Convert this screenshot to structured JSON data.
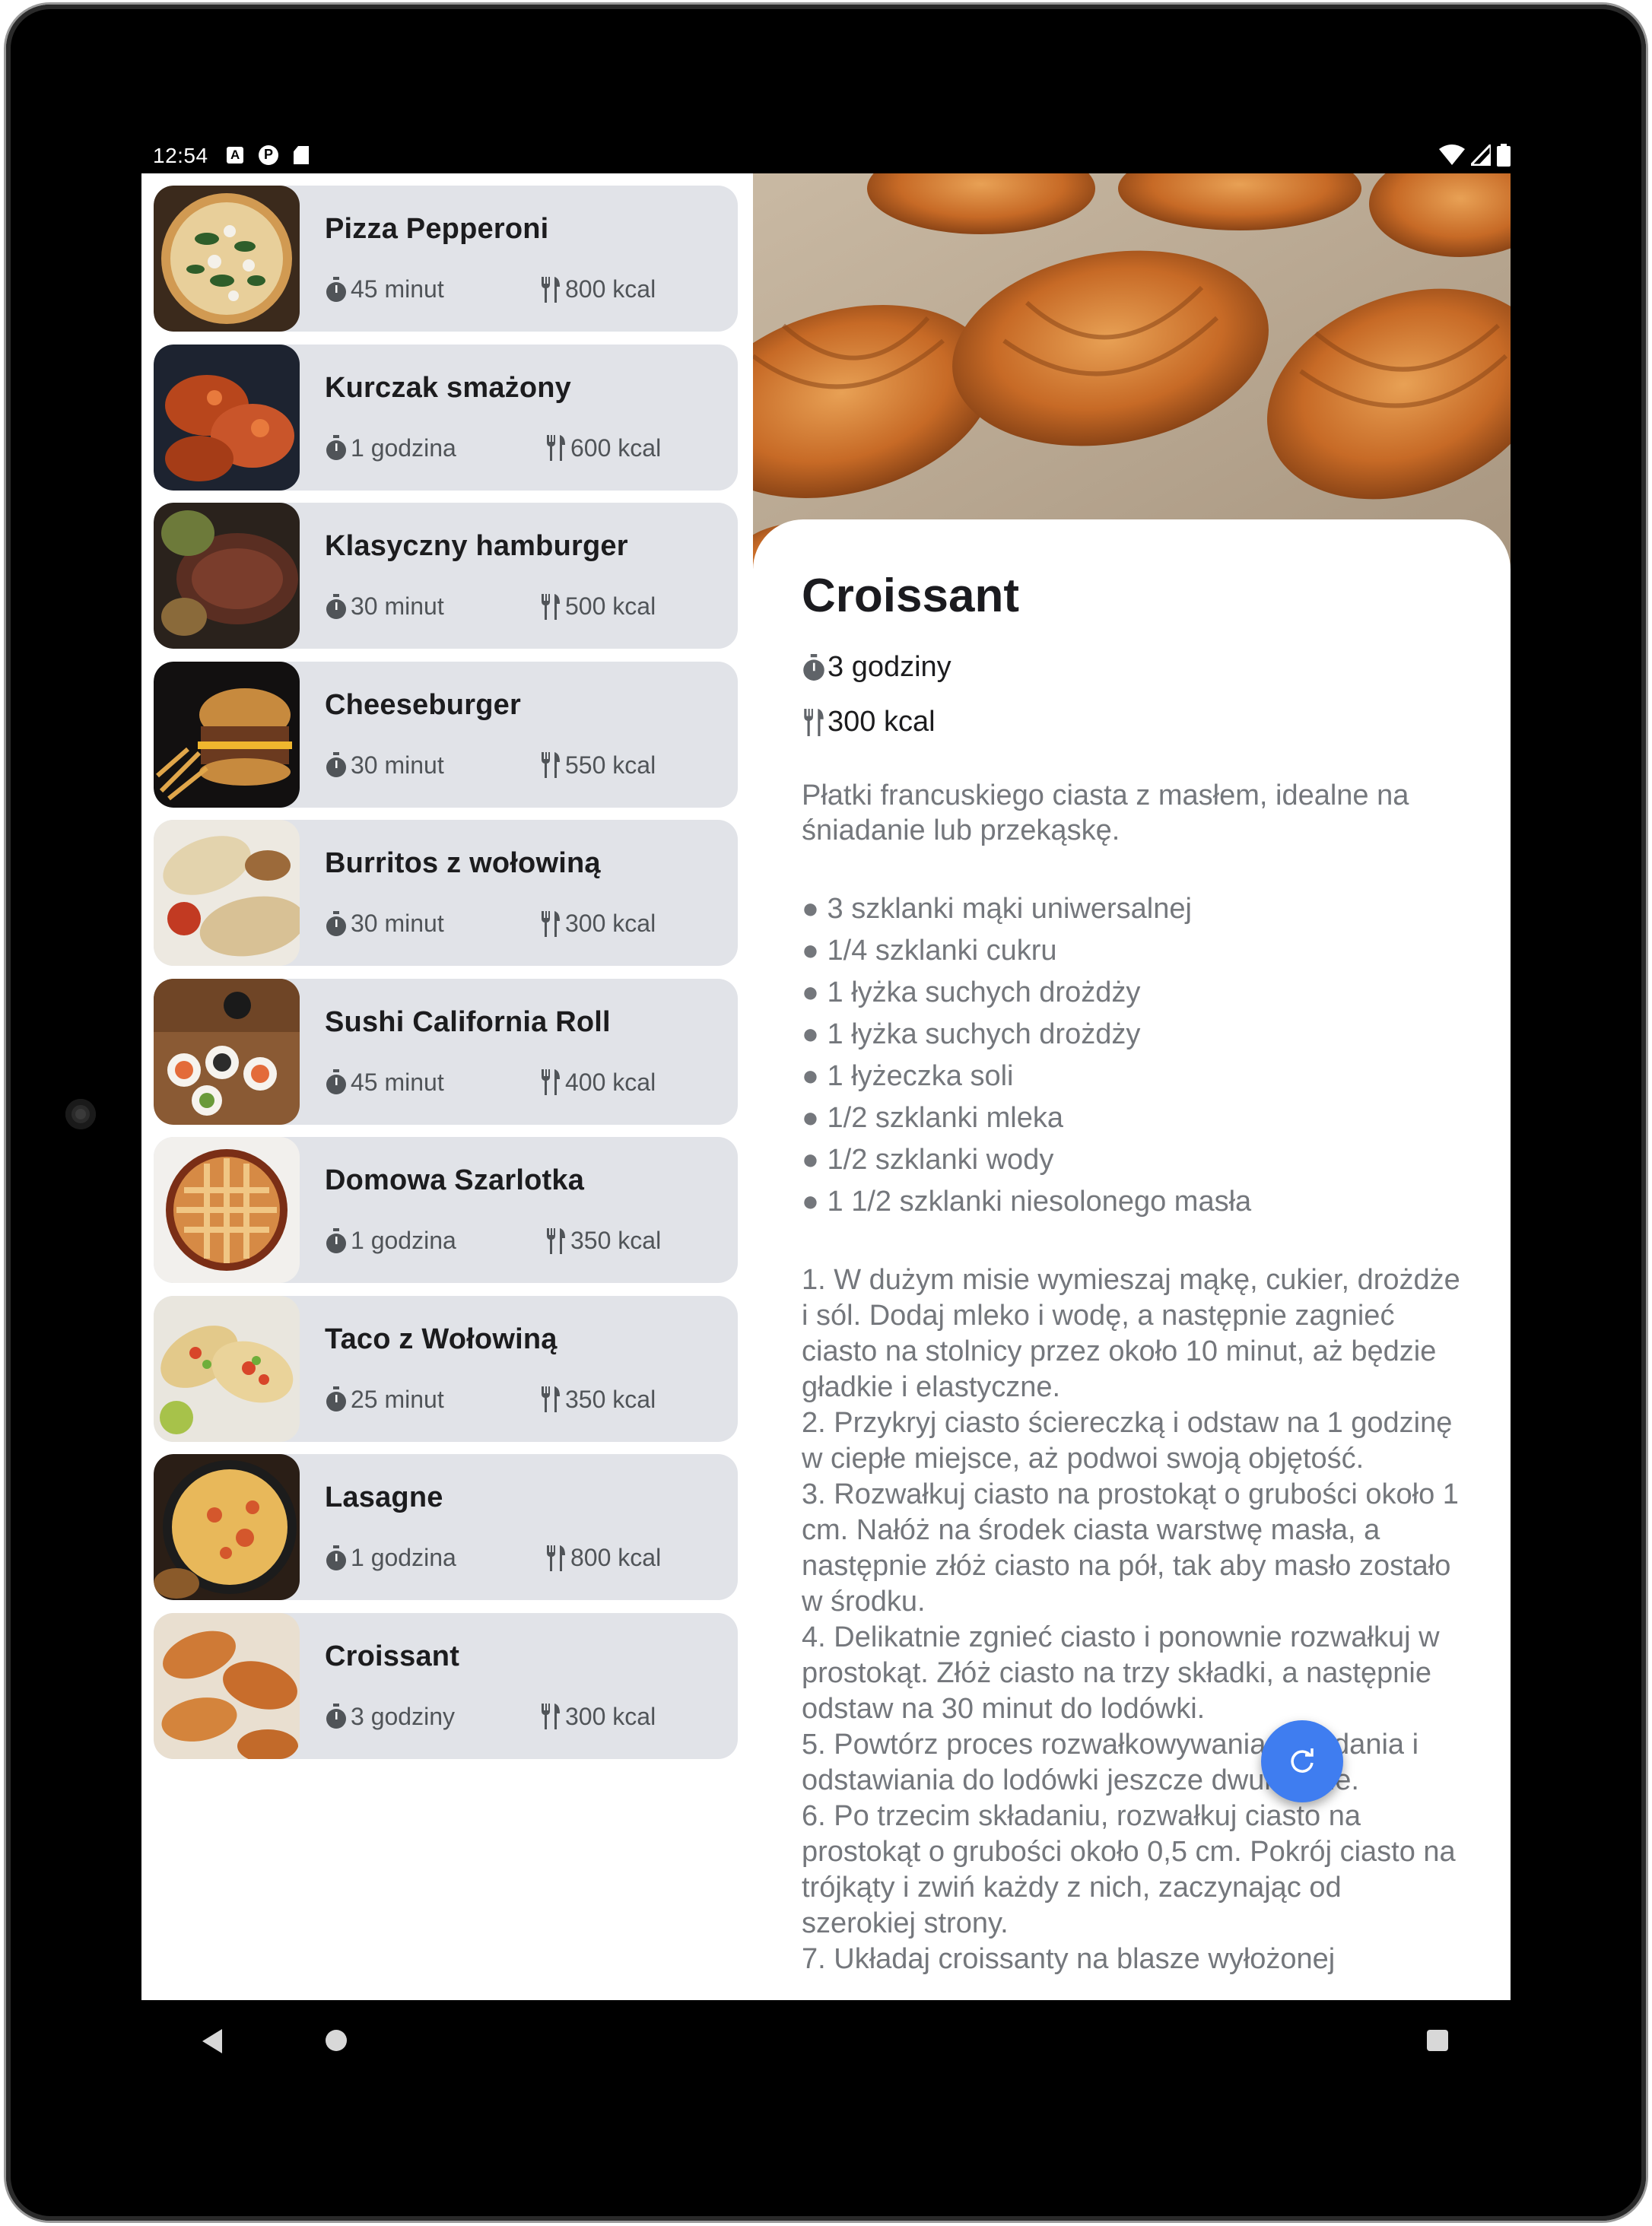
{
  "status_bar": {
    "time": "12:54",
    "left_icons": [
      "notification-a-icon",
      "notification-p-icon",
      "sd-card-icon"
    ],
    "right_icons": [
      "wifi-icon",
      "cell-signal-icon",
      "battery-icon"
    ]
  },
  "recipes": [
    {
      "name": "Pizza Pepperoni",
      "time": "45 minut",
      "kcal": "800 kcal",
      "image": "pizza-image"
    },
    {
      "name": "Kurczak smażony",
      "time": "1 godzina",
      "kcal": "600 kcal",
      "image": "fried-chicken-image"
    },
    {
      "name": "Klasyczny hamburger",
      "time": "30 minut",
      "kcal": "500 kcal",
      "image": "hamburger-image"
    },
    {
      "name": "Cheeseburger",
      "time": "30 minut",
      "kcal": "550 kcal",
      "image": "cheeseburger-image"
    },
    {
      "name": "Burritos z wołowiną",
      "time": "30 minut",
      "kcal": "300 kcal",
      "image": "burritos-image"
    },
    {
      "name": "Sushi California Roll",
      "time": "45 minut",
      "kcal": "400 kcal",
      "image": "sushi-image"
    },
    {
      "name": "Domowa Szarlotka",
      "time": "1 godzina",
      "kcal": "350 kcal",
      "image": "apple-pie-image"
    },
    {
      "name": "Taco z Wołowiną",
      "time": "25 minut",
      "kcal": "350 kcal",
      "image": "taco-image"
    },
    {
      "name": "Lasagne",
      "time": "1 godzina",
      "kcal": "800 kcal",
      "image": "lasagne-image"
    },
    {
      "name": "Croissant",
      "time": "3 godziny",
      "kcal": "300 kcal",
      "image": "croissant-image"
    }
  ],
  "detail": {
    "title": "Croissant",
    "time": "3 godziny",
    "kcal": "300 kcal",
    "description": "Płatki francuskiego ciasta z masłem, idealne na śniadanie lub przekąskę.",
    "ingredients": [
      "● 3 szklanki mąki uniwersalnej",
      "● 1/4 szklanki cukru",
      "● 1 łyżka suchych drożdży",
      "● 1 łyżka suchych drożdży",
      "● 1 łyżeczka soli",
      "● 1/2 szklanki mleka",
      "● 1/2 szklanki wody",
      "● 1 1/2 szklanki niesolonego masła"
    ],
    "steps": [
      "1. W dużym misie wymieszaj mąkę, cukier, drożdże i sól. Dodaj mleko i wodę, a następnie zagnieć ciasto na stolnicy przez około 10 minut, aż będzie gładkie i elastyczne.",
      "2. Przykryj ciasto ściereczką i odstaw na 1 godzinę w ciepłe miejsce, aż podwoi swoją objętość.",
      "3. Rozwałkuj ciasto na prostokąt o grubości około 1 cm. Nałóż na środek ciasta warstwę masła, a następnie złóż ciasto na pół, tak aby masło zostało w środku.",
      "4. Delikatnie zgnieć ciasto i ponownie rozwałkuj w prostokąt. Złóż ciasto na trzy składki, a następnie odstaw na 30 minut do lodówki.",
      "5. Powtórz proces rozwałkowywania, składania i odstawiania do lodówki jeszcze dwukrotnie.",
      "6. Po trzecim składaniu, rozwałkuj ciasto na prostokąt o grubości około 0,5 cm. Pokrój ciasto na trójkąty i zwiń każdy z nich, zaczynając od szerokiej strony.",
      "7. Układaj croissanty na blasze wyłożonej"
    ]
  },
  "fab_icon": "refresh-icon",
  "nav_icons": [
    "back-icon",
    "home-icon",
    "recents-icon"
  ],
  "colors": {
    "card_bg": "#e1e3e8",
    "fab": "#3f7df0",
    "text_muted": "#74777c"
  }
}
